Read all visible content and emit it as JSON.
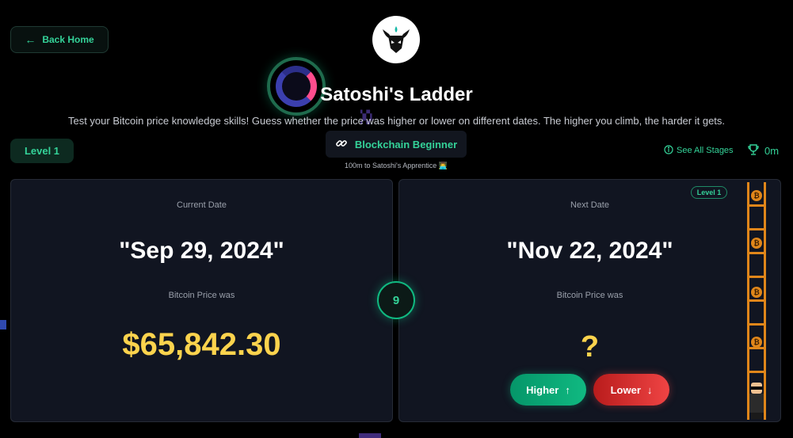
{
  "nav": {
    "back_label": "Back Home",
    "back_icon": "arrow-left-icon"
  },
  "header": {
    "logo_icon": "bull-logo-icon",
    "title": "Satoshi's Ladder",
    "subtitle": "Test your Bitcoin price knowledge skills! Guess whether the price was higher or lower on different dates. The higher you climb, the harder it gets."
  },
  "status": {
    "level_label": "Level 1",
    "rank_icon": "link-icon",
    "rank_label": "Blockchain Beginner",
    "rank_subtext": "100m to Satoshi's Apprentice 👨‍💻",
    "see_stages_icon": "info-icon",
    "see_stages_label": "See All Stages",
    "trophy_icon": "trophy-icon",
    "height": "0m"
  },
  "current": {
    "label": "Current Date",
    "date": "\"Sep 29, 2024\"",
    "price_label": "Bitcoin Price was",
    "price": "$65,842.30"
  },
  "streak": {
    "value": "9"
  },
  "next": {
    "level_badge": "Level 1",
    "label": "Next Date",
    "date": "\"Nov 22, 2024\"",
    "price_label": "Bitcoin Price was",
    "price": "?",
    "higher_label": "Higher",
    "lower_label": "Lower"
  },
  "ladder": {
    "coin_symbol": "₿"
  },
  "colors": {
    "accent": "#34d399",
    "price": "#fcd34d",
    "higher": "#10b981",
    "lower": "#ef4444",
    "ladder": "#e0861a"
  }
}
